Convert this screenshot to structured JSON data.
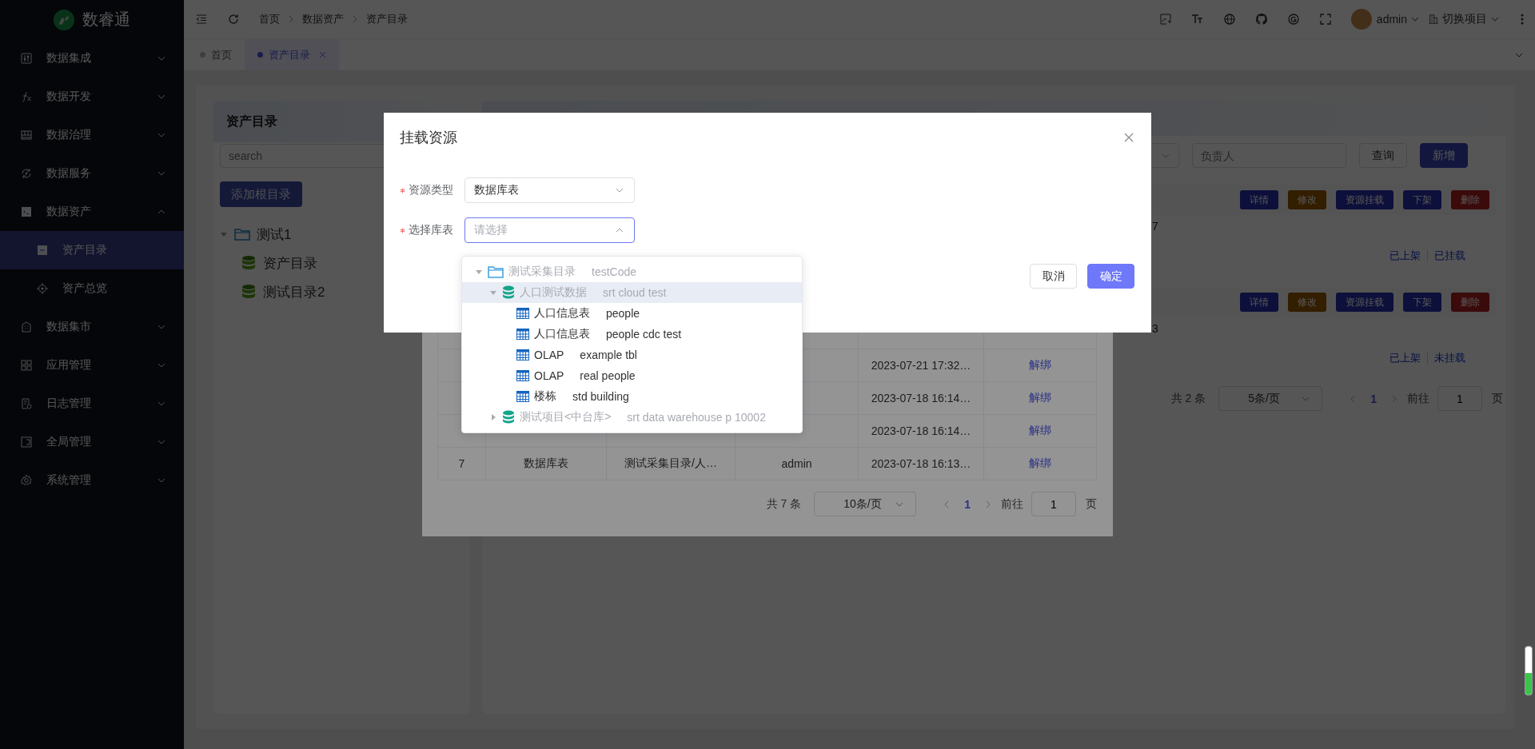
{
  "sidebar": {
    "logo_text": "数睿通",
    "items": [
      {
        "label": "数据集成",
        "expanded": false
      },
      {
        "label": "数据开发",
        "expanded": false
      },
      {
        "label": "数据治理",
        "expanded": false
      },
      {
        "label": "数据服务",
        "expanded": false
      },
      {
        "label": "数据资产",
        "expanded": true,
        "children": [
          {
            "label": "资产目录",
            "selected": true
          },
          {
            "label": "资产总览",
            "selected": false
          }
        ]
      },
      {
        "label": "数据集市",
        "expanded": false
      },
      {
        "label": "应用管理",
        "expanded": false
      },
      {
        "label": "日志管理",
        "expanded": false
      },
      {
        "label": "全局管理",
        "expanded": false
      },
      {
        "label": "系统管理",
        "expanded": false
      }
    ]
  },
  "header": {
    "breadcrumb": [
      "首页",
      "数据资产",
      "资产目录"
    ],
    "user": "admin",
    "project_switch": "切换项目"
  },
  "tabs": [
    {
      "label": "首页",
      "selected": false,
      "closable": false
    },
    {
      "label": "资产目录",
      "selected": true,
      "closable": true
    }
  ],
  "catalog_panel": {
    "title": "资产目录",
    "search_placeholder": "search",
    "add_button": "添加根目录",
    "tree": [
      {
        "label": "测试1",
        "kind": "folder",
        "expanded": true,
        "children": [
          {
            "label": "资产目录",
            "kind": "asset"
          },
          {
            "label": "测试目录2",
            "kind": "asset"
          }
        ]
      }
    ]
  },
  "asset_list": {
    "owner_placeholder": "负责人",
    "query_button": "查询",
    "add_button": "新增",
    "items": [
      {
        "actions": [
          {
            "label": "详情",
            "kind": "primary"
          },
          {
            "label": "修改",
            "kind": "warning"
          },
          {
            "label": "资源挂载",
            "kind": "primary"
          },
          {
            "label": "下架",
            "kind": "primary"
          },
          {
            "label": "删除",
            "kind": "danger"
          }
        ],
        "date_fragment": "7",
        "tags": [
          "已上架",
          "已挂载"
        ]
      },
      {
        "actions": [
          {
            "label": "详情",
            "kind": "primary"
          },
          {
            "label": "修改",
            "kind": "warning"
          },
          {
            "label": "资源挂载",
            "kind": "primary"
          },
          {
            "label": "下架",
            "kind": "primary"
          },
          {
            "label": "删除",
            "kind": "danger"
          }
        ],
        "date_fragment": "3",
        "tags": [
          "已上架",
          "未挂载"
        ]
      }
    ],
    "pagination": {
      "total": "共 2 条",
      "page_size": "5条/页",
      "pages": [
        {
          "label": "1",
          "selected": true
        }
      ],
      "goto_label": "前往",
      "goto_value": "1",
      "page_suffix": "页"
    }
  },
  "mounted_resources_dialog": {
    "rows": [
      {
        "time": "2023-07-21 17:32…",
        "action": "解绑"
      },
      {
        "time": "2023-07-18 16:14…",
        "action": "解绑"
      },
      {
        "time": "2023-07-18 16:14…",
        "action": "解绑"
      },
      {
        "index": "7",
        "type": "数据库表",
        "path": "测试采集目录/人…",
        "creator": "admin",
        "time": "2023-07-18 16:13…",
        "action": "解绑"
      }
    ],
    "pagination": {
      "total": "共 7 条",
      "page_size": "10条/页",
      "pages": [
        {
          "label": "1",
          "selected": true
        }
      ],
      "goto_label": "前往",
      "goto_value": "1",
      "page_suffix": "页"
    }
  },
  "mount_dialog": {
    "title": "挂载资源",
    "fields": [
      {
        "label": "资源类型",
        "required": true,
        "value": "数据库表",
        "open": false
      },
      {
        "label": "选择库表",
        "required": true,
        "placeholder": "请选择",
        "open": true
      }
    ],
    "tree": [
      {
        "label": "测试采集目录",
        "code": "testCode",
        "kind": "folder",
        "expanded": true,
        "highlighted": false,
        "children": [
          {
            "label": "人口测试数据",
            "code": "srt cloud test",
            "kind": "database",
            "expanded": true,
            "highlighted": true,
            "children": [
              {
                "label": "人口信息表",
                "code": "people",
                "kind": "table",
                "highlighted": false
              },
              {
                "label": "人口信息表",
                "code": "people cdc test",
                "kind": "table",
                "highlighted": false
              },
              {
                "label": "OLAP",
                "code": "example tbl",
                "kind": "table",
                "highlighted": false
              },
              {
                "label": "OLAP",
                "code": "real people",
                "kind": "table",
                "highlighted": false
              },
              {
                "label": "楼栋",
                "code": "std building",
                "kind": "table",
                "highlighted": false
              }
            ]
          },
          {
            "label": "测试项目<中台库>",
            "code": "srt data warehouse p 10002",
            "kind": "database",
            "expanded": false,
            "highlighted": false
          }
        ]
      }
    ],
    "buttons": [
      {
        "label": "取消",
        "kind": "default"
      },
      {
        "label": "确定",
        "kind": "primary"
      }
    ]
  }
}
